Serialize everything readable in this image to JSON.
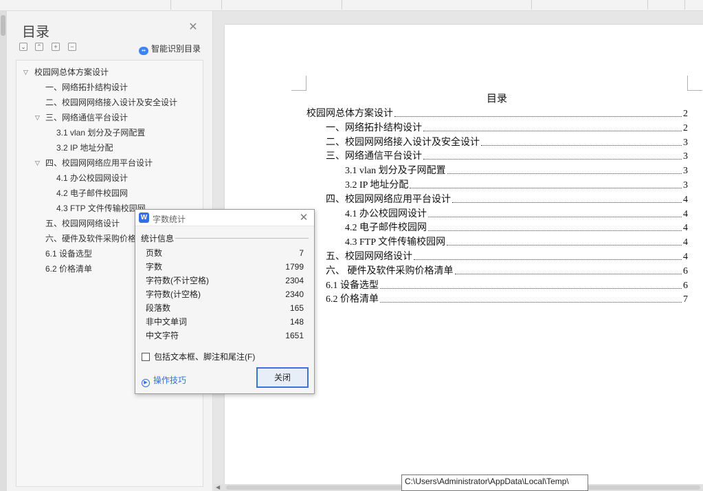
{
  "toc_panel": {
    "title": "目录",
    "smart_toc_label": "智能识别目录",
    "tools": [
      "collapse-all",
      "expand-all",
      "add-level",
      "remove-level"
    ],
    "items": [
      {
        "label": "校园网总体方案设计",
        "level": 0,
        "expanded": true
      },
      {
        "label": "一、网络拓扑结构设计",
        "level": 1
      },
      {
        "label": "二、校园网网络接入设计及安全设计",
        "level": 1
      },
      {
        "label": "三、网络通信平台设计",
        "level": 1,
        "expanded": true
      },
      {
        "label": "3.1 vlan 划分及子网配置",
        "level": 2
      },
      {
        "label": "3.2 IP 地址分配",
        "level": 2
      },
      {
        "label": "四、校园网网络应用平台设计",
        "level": 1,
        "expanded": true
      },
      {
        "label": "4.1 办公校园网设计",
        "level": 2
      },
      {
        "label": "4.2 电子邮件校园网",
        "level": 2
      },
      {
        "label": "4.3 FTP 文件传输校园网",
        "level": 2
      },
      {
        "label": "五、校园网网络设计",
        "level": 1
      },
      {
        "label": "六、硬件及软件采购价格",
        "level": 1
      },
      {
        "label": "6.1 设备选型",
        "level": 0
      },
      {
        "label": "6.2 价格清单",
        "level": 0
      }
    ]
  },
  "document": {
    "heading": "目录",
    "entries": [
      {
        "text": "校园网总体方案设计",
        "page": "2",
        "indent": 0
      },
      {
        "text": "一、网络拓扑结构设计",
        "page": "2",
        "indent": 1
      },
      {
        "text": "二、校园网网络接入设计及安全设计",
        "page": "3",
        "indent": 1
      },
      {
        "text": "三、网络通信平台设计",
        "page": "3",
        "indent": 1
      },
      {
        "text": "3.1 vlan 划分及子网配置",
        "page": "3",
        "indent": 2
      },
      {
        "text": "3.2 IP 地址分配",
        "page": "3",
        "indent": 2
      },
      {
        "text": "四、校园网网络应用平台设计",
        "page": "4",
        "indent": 1
      },
      {
        "text": "4.1 办公校园网设计",
        "page": "4",
        "indent": 2
      },
      {
        "text": "4.2 电子邮件校园网",
        "page": "4",
        "indent": 2
      },
      {
        "text": "4.3 FTP 文件传输校园网",
        "page": "4",
        "indent": 2
      },
      {
        "text": "五、校园网网络设计",
        "page": "4",
        "indent": 1
      },
      {
        "text": "六、 硬件及软件采购价格清单",
        "page": "6",
        "indent": 1
      },
      {
        "text": "6.1 设备选型",
        "page": "6",
        "indent": 1
      },
      {
        "text": "6.2 价格清单",
        "page": "7",
        "indent": 1
      }
    ]
  },
  "dialog": {
    "title": "字数统计",
    "section_label": "统计信息",
    "stats": [
      {
        "label": "页数",
        "value": "7"
      },
      {
        "label": "字数",
        "value": "1799"
      },
      {
        "label": "字符数(不计空格)",
        "value": "2304"
      },
      {
        "label": "字符数(计空格)",
        "value": "2340"
      },
      {
        "label": "段落数",
        "value": "165"
      },
      {
        "label": "非中文单词",
        "value": "148"
      },
      {
        "label": "中文字符",
        "value": "1651"
      }
    ],
    "checkbox_label": "包括文本框、脚注和尾注(F)",
    "checkbox_checked": false,
    "tips_label": "操作技巧",
    "close_label": "关闭"
  },
  "tooltip": {
    "text": "C:\\Users\\Administrator\\AppData\\Local\\Temp\\"
  },
  "colors": {
    "accent": "#2f6fea",
    "button_border": "#3c74d6"
  }
}
